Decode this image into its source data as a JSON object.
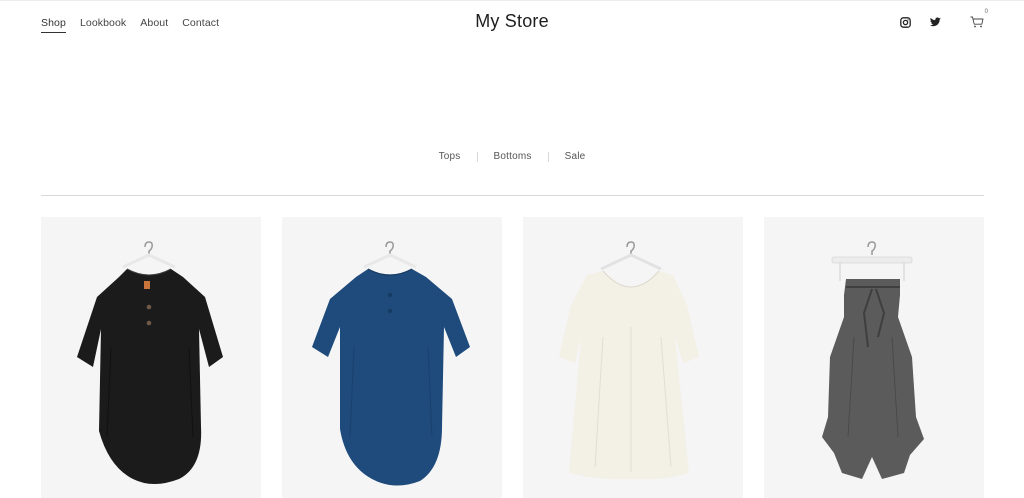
{
  "header": {
    "nav": [
      "Shop",
      "Lookbook",
      "About",
      "Contact"
    ],
    "active_nav": "Shop",
    "store_name": "My Store",
    "social_icons": [
      "instagram-icon",
      "twitter-icon"
    ],
    "cart": {
      "icon": "cart-icon",
      "count": "0"
    }
  },
  "categories": [
    "Tops",
    "Bottoms",
    "Sale"
  ],
  "products": [
    {
      "image": "black-linen-tunic",
      "color": "#1b1b1c"
    },
    {
      "image": "blue-linen-tunic",
      "color": "#1e4a7c"
    },
    {
      "image": "cream-dress",
      "color": "#f3f0e6"
    },
    {
      "image": "grey-wrap-trousers",
      "color": "#5b5b5b"
    }
  ]
}
